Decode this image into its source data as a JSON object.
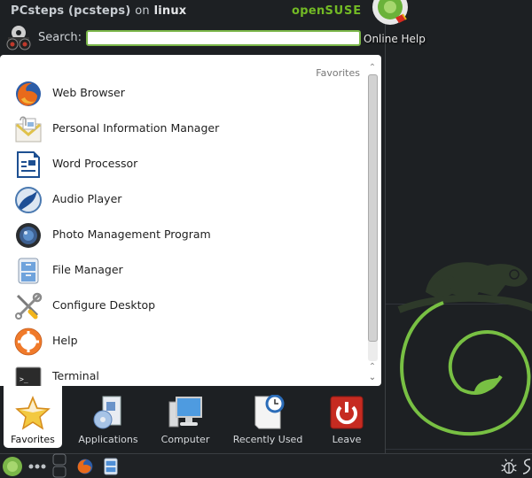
{
  "header": {
    "user_display": "PCsteps (pcsteps)",
    "on_word": "on",
    "host": "linux",
    "brand_open": "open",
    "brand_suse": "SUSE",
    "search_label": "Search:",
    "search_value": "",
    "search_placeholder": ""
  },
  "desktop": {
    "online_help_label": "Online Help"
  },
  "favorites": {
    "section_title": "Favorites",
    "items": [
      {
        "label": "Web Browser",
        "icon": "firefox-icon"
      },
      {
        "label": "Personal Information Manager",
        "icon": "kontact-icon"
      },
      {
        "label": "Word Processor",
        "icon": "libreoffice-writer-icon"
      },
      {
        "label": "Audio Player",
        "icon": "amarok-icon"
      },
      {
        "label": "Photo Management Program",
        "icon": "digikam-icon"
      },
      {
        "label": "File Manager",
        "icon": "file-manager-icon"
      },
      {
        "label": "Configure Desktop",
        "icon": "configure-icon"
      },
      {
        "label": "Help",
        "icon": "help-lifebuoy-icon"
      },
      {
        "label": "Terminal",
        "icon": "terminal-icon"
      }
    ]
  },
  "tabs": [
    {
      "label": "Favorites",
      "active": true
    },
    {
      "label": "Applications",
      "active": false
    },
    {
      "label": "Computer",
      "active": false
    },
    {
      "label": "Recently Used",
      "active": false
    },
    {
      "label": "Leave",
      "active": false
    }
  ],
  "colors": {
    "accent": "#73ba25",
    "search_border": "#7ab648",
    "panel_bg": "#ffffff",
    "desktop_bg": "#1d2023"
  }
}
